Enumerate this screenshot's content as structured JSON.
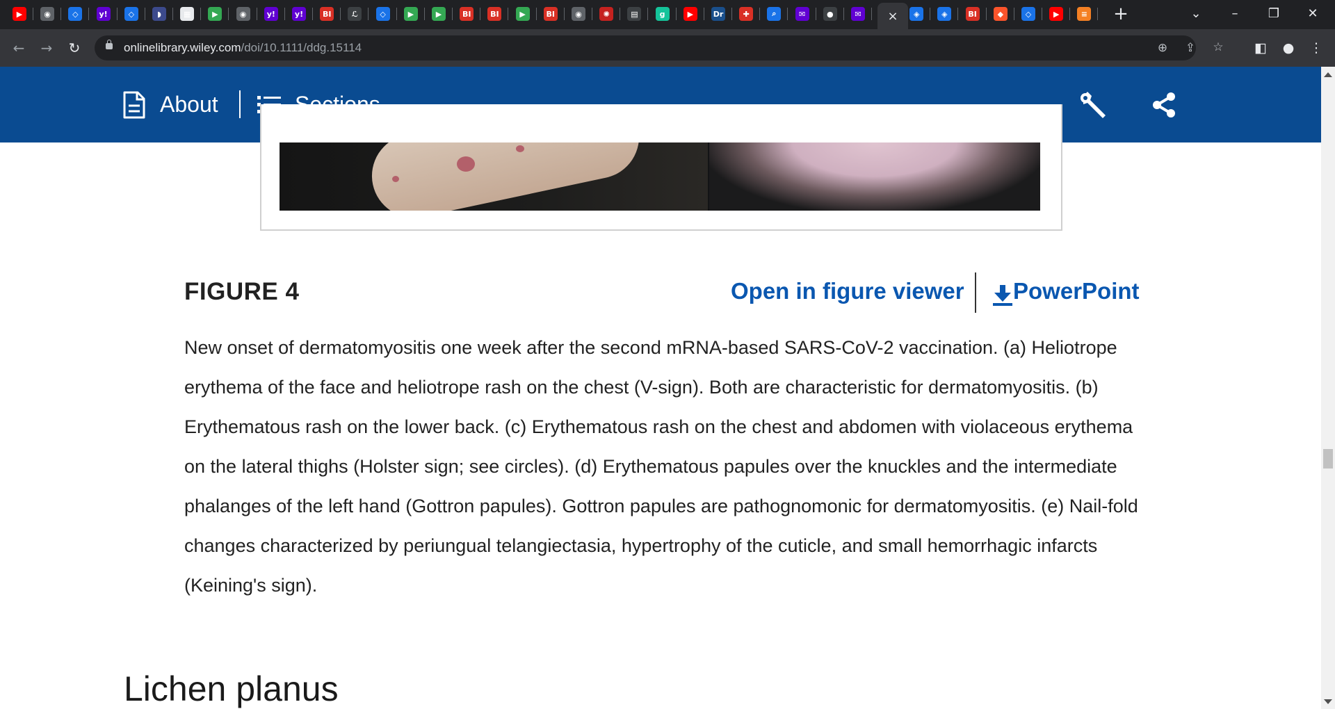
{
  "browser": {
    "tabs": [
      {
        "icon": "youtube-icon",
        "color": "#ff0000",
        "glyph": "▶"
      },
      {
        "icon": "globe-icon",
        "color": "#5f6368",
        "glyph": "◉"
      },
      {
        "icon": "shield-icon",
        "color": "#1a73e8",
        "glyph": "◇"
      },
      {
        "icon": "yahoo-icon",
        "color": "#6001d2",
        "glyph": "y!"
      },
      {
        "icon": "shield-icon",
        "color": "#1a73e8",
        "glyph": "◇"
      },
      {
        "icon": "bookmark-icon",
        "color": "#3c4a8c",
        "glyph": "◗"
      },
      {
        "icon": "grid-icon",
        "color": "#e8eaed",
        "glyph": "▦"
      },
      {
        "icon": "play-icon",
        "color": "#34a853",
        "glyph": "▶"
      },
      {
        "icon": "globe-icon",
        "color": "#5f6368",
        "glyph": "◉"
      },
      {
        "icon": "yahoo-icon",
        "color": "#6001d2",
        "glyph": "y!"
      },
      {
        "icon": "yahoo-icon",
        "color": "#6001d2",
        "glyph": "y!"
      },
      {
        "icon": "business-insider-icon",
        "color": "#d93025",
        "glyph": "BI"
      },
      {
        "icon": "script-icon",
        "color": "#3c4043",
        "glyph": "ℒ"
      },
      {
        "icon": "shield-icon",
        "color": "#1a73e8",
        "glyph": "◇"
      },
      {
        "icon": "play-icon",
        "color": "#34a853",
        "glyph": "▶"
      },
      {
        "icon": "play-icon",
        "color": "#34a853",
        "glyph": "▶"
      },
      {
        "icon": "business-insider-icon",
        "color": "#d93025",
        "glyph": "BI"
      },
      {
        "icon": "business-insider-icon",
        "color": "#d93025",
        "glyph": "BI"
      },
      {
        "icon": "play-icon",
        "color": "#34a853",
        "glyph": "▶"
      },
      {
        "icon": "business-insider-icon",
        "color": "#d93025",
        "glyph": "BI"
      },
      {
        "icon": "globe-icon",
        "color": "#5f6368",
        "glyph": "◉"
      },
      {
        "icon": "burst-icon",
        "color": "#c5221f",
        "glyph": "✺"
      },
      {
        "icon": "news-icon",
        "color": "#3c4043",
        "glyph": "▤"
      },
      {
        "icon": "grammarly-icon",
        "color": "#15c39a",
        "glyph": "g"
      },
      {
        "icon": "youtube-icon",
        "color": "#ff0000",
        "glyph": "▶"
      },
      {
        "icon": "dr-icon",
        "color": "#1a4f8b",
        "glyph": "Dr"
      },
      {
        "icon": "mic-icon",
        "color": "#d93025",
        "glyph": "✚"
      },
      {
        "icon": "search-icon",
        "color": "#1a73e8",
        "glyph": "⌕"
      },
      {
        "icon": "mail-icon",
        "color": "#6001d2",
        "glyph": "✉"
      },
      {
        "icon": "circle-icon",
        "color": "#3c4043",
        "glyph": "●"
      },
      {
        "icon": "mail-icon",
        "color": "#6001d2",
        "glyph": "✉"
      },
      {
        "icon": "cube-icon",
        "color": "#1a73e8",
        "glyph": "◈"
      },
      {
        "icon": "cube-icon",
        "color": "#1a73e8",
        "glyph": "◈"
      },
      {
        "icon": "business-insider-icon",
        "color": "#d93025",
        "glyph": "BI"
      },
      {
        "icon": "brave-icon",
        "color": "#fb542b",
        "glyph": "◆"
      },
      {
        "icon": "shield-icon",
        "color": "#1a73e8",
        "glyph": "◇"
      },
      {
        "icon": "youtube-icon",
        "color": "#ff0000",
        "glyph": "▶"
      },
      {
        "icon": "stack-icon",
        "color": "#f48024",
        "glyph": "≡"
      }
    ],
    "active_tab_close": "×",
    "new_tab": "+",
    "url_host": "onlinelibrary.wiley.com",
    "url_path": "/doi/10.1111/ddg.15114"
  },
  "site_header": {
    "about_label": "About",
    "sections_label": "Sections"
  },
  "figure": {
    "title": "FIGURE 4",
    "open_viewer_label": "Open in figure viewer",
    "powerpoint_label": "PowerPoint",
    "caption": "New onset of dermatomyositis one week after the second mRNA-based SARS-CoV-2 vaccination. (a) Heliotrope erythema of the face and heliotrope rash on the chest (V-sign). Both are characteristic for dermatomyositis. (b) Erythematous rash on the lower back. (c) Erythematous rash on the chest and abdomen with violaceous erythema on the lateral thighs (Holster sign; see circles). (d) Erythematous papules over the knuckles and the intermediate phalanges of the left hand (Gottron papules). Gottron papules are pathognomonic for dermatomyositis. (e) Nail-fold changes characterized by periungual telangiectasia, hypertrophy of the cuticle, and small hemorrhagic infarcts (Keining's sign)."
  },
  "next_section": {
    "heading": "Lichen planus"
  },
  "colors": {
    "header_blue": "#0a4b91",
    "link_blue": "#0a57b0"
  }
}
